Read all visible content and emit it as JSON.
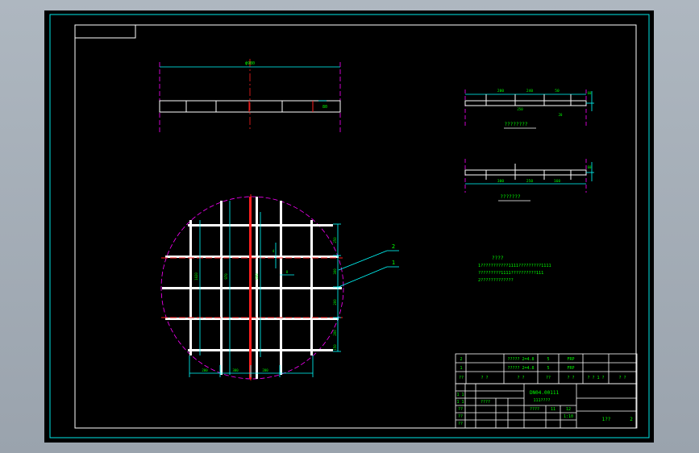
{
  "colors": {
    "background": "#000000",
    "frame": "#00e6e6",
    "text": "#00ff00",
    "white": "#ffffff",
    "red": "#ff2020",
    "magenta": "#ff00ff",
    "cyan": "#00ffff",
    "window_bg": "#a3acb6"
  },
  "top_view": {
    "dim_overall": "ф980",
    "dim_height": "80"
  },
  "section_1": {
    "dims": [
      "200",
      "240",
      "50",
      "250",
      "20"
    ],
    "dim_height": "60",
    "caption": "????????"
  },
  "section_2": {
    "dims": [
      "300",
      "250",
      "160"
    ],
    "caption": "???????",
    "dim_height": "60"
  },
  "plan_view": {
    "callouts": [
      "2",
      "1"
    ],
    "dims_bottom": [
      "200",
      "300",
      "200"
    ],
    "dims_right": [
      "250",
      "300",
      "200",
      "200",
      "150"
    ],
    "dims_internal": [
      "1020",
      "970",
      "600",
      "4",
      "8"
    ]
  },
  "notes": {
    "title": "????",
    "lines": [
      "1???????????1111?????????1111",
      "?????????1111??????????111",
      "2?????????????"
    ]
  },
  "parts_table": {
    "rows": [
      [
        "2",
        "",
        "????? 2=4.8",
        "5",
        "FRP",
        "",
        ""
      ],
      [
        "1",
        "",
        "????? 2=4.8",
        "5",
        "FRP",
        "",
        ""
      ],
      [
        "??",
        "? ?",
        "? ?",
        "??",
        "? ?",
        "? ?\n1 ?",
        "? ?"
      ]
    ]
  },
  "title_block": {
    "drawing_name": "DN04.00111",
    "drawing_sub": "111????",
    "left_cells": [
      "1 1",
      "1 1",
      "????",
      "??",
      "??",
      "??"
    ],
    "mid_cells": [
      "????",
      "11",
      "12",
      "1:10"
    ],
    "sheet_no": "1??",
    "sheet_of": "2"
  }
}
